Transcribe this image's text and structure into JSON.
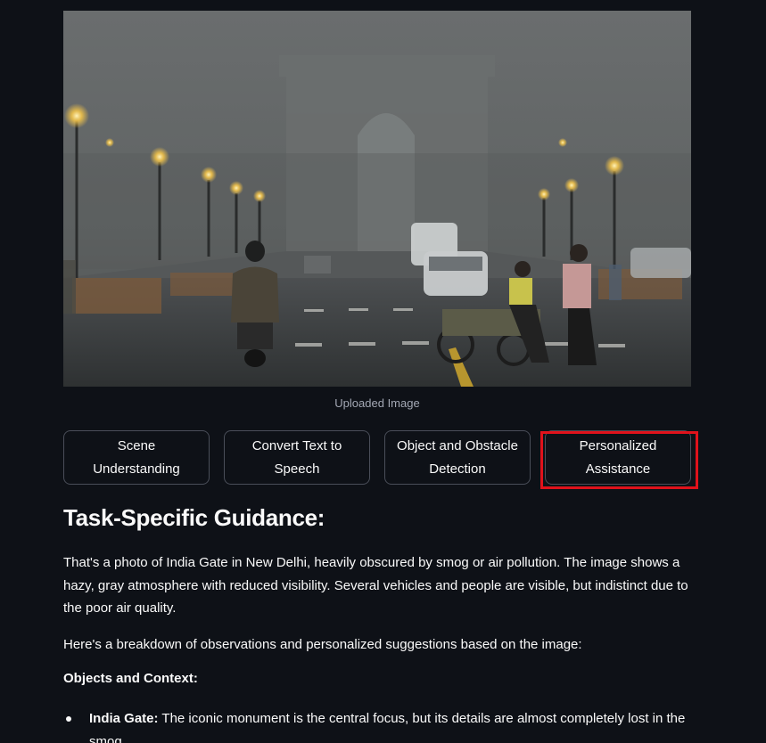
{
  "image": {
    "caption": "Uploaded Image",
    "depicts": "India Gate in smog with street lamps, motorcycle, cart and people"
  },
  "buttons": [
    {
      "line1": "Scene",
      "line2": "Understanding"
    },
    {
      "line1": "Convert Text to",
      "line2": "Speech"
    },
    {
      "line1": "Object and Obstacle",
      "line2": "Detection"
    },
    {
      "line1": "Personalized",
      "line2": "Assistance"
    }
  ],
  "highlight_color": "#e0121b",
  "result": {
    "heading": "Task-Specific Guidance:",
    "para1": "That's a photo of India Gate in New Delhi, heavily obscured by smog or air pollution. The image shows a hazy, gray atmosphere with reduced visibility. Several vehicles and people are visible, but indistinct due to the poor air quality.",
    "para2": "Here's a breakdown of observations and personalized suggestions based on the image:",
    "section_label": "Objects and Context:",
    "bullets": [
      {
        "term": "India Gate:",
        "text": " The iconic monument is the central focus, but its details are almost completely lost in the smog."
      }
    ]
  },
  "colors": {
    "background": "#0e1117",
    "text": "#fafafa",
    "muted": "#a3a8b4",
    "button_border": "#4a4e59"
  }
}
